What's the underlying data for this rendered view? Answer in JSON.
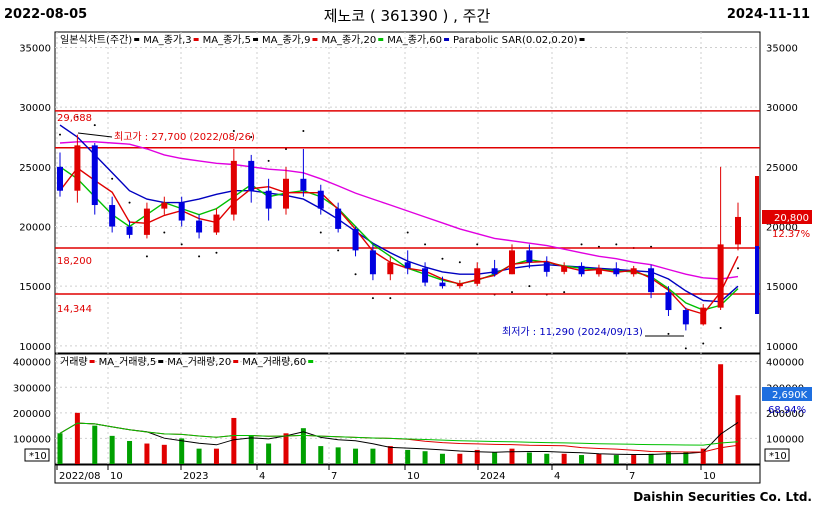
{
  "header": {
    "start_date": "2022-08-05",
    "title": "제노코 ( 361390 ) , 주간",
    "end_date": "2024-11-11"
  },
  "footer": {
    "brand": "Daishin Securities Co. Ltd."
  },
  "legend_price": [
    {
      "label": "일본식차트(주간)",
      "color": "#000000"
    },
    {
      "label": "MA_종가,3",
      "color": "#e00000"
    },
    {
      "label": "MA_종가,5",
      "color": "#000000"
    },
    {
      "label": "MA_종가,9",
      "color": "#e00000"
    },
    {
      "label": "MA_종가,20",
      "color": "#00c000"
    },
    {
      "label": "MA_종가,60",
      "color": "#0000c0"
    },
    {
      "label": "Parabolic SAR(0.02,0.20)",
      "color": "#000000"
    }
  ],
  "legend_volume": [
    {
      "label": "거래량",
      "color": "#e00000"
    },
    {
      "label": "MA_거래량,5",
      "color": "#000000"
    },
    {
      "label": "MA_거래량,20",
      "color": "#e00000"
    },
    {
      "label": "MA_거래량,60",
      "color": "#00c000"
    }
  ],
  "price_axis": {
    "ticks": [
      "35000",
      "30000",
      "25000",
      "20000",
      "15000",
      "10000"
    ]
  },
  "volume_axis": {
    "ticks": [
      "400000",
      "300000",
      "200000",
      "100000"
    ],
    "unit": "*10"
  },
  "x_ticks": [
    "2022/08",
    "10",
    "2023",
    "4",
    "7",
    "10",
    "2024",
    "4",
    "7",
    "10"
  ],
  "levels": [
    {
      "label": "29,688",
      "value": 29688
    },
    {
      "label": "",
      "value": 26600
    },
    {
      "label": "18,200",
      "value": 18200
    },
    {
      "label": "14,344",
      "value": 14344
    }
  ],
  "annotations": {
    "high": "최고가 : 27,700 (2022/08/26)",
    "low": "최저가 : 11,290 (2024/09/13)"
  },
  "badges": {
    "price": "20,800",
    "price_pct": "12.37%",
    "volume": "2,690K",
    "volume_pct": "68.94%"
  },
  "colors": {
    "up": "#e00000",
    "down": "#0000e0",
    "ma3": "#e00000",
    "ma20": "#00c000",
    "ma60": "#0000c0",
    "ma120": "#e000e0",
    "level": "#e00000",
    "sar": "#000000"
  },
  "chart_data": {
    "type": "candlestick",
    "series": [
      {
        "name": "MA_종가,20",
        "values": [
          25000,
          24000,
          22500,
          21000,
          20000,
          21000,
          22000,
          21500,
          21000,
          21500,
          22500,
          23500,
          22500,
          22800,
          23000,
          22500,
          21500,
          20000,
          18500,
          17500,
          16500,
          16000,
          15500,
          15200,
          15500,
          16000,
          16800,
          17200,
          17000,
          16700,
          16500,
          16400,
          16300,
          16200,
          15800,
          14800,
          13600,
          13000,
          13400,
          14800
        ]
      },
      {
        "name": "MA_종가,60",
        "values": [
          28500,
          27500,
          26000,
          24500,
          23000,
          22300,
          22000,
          22000,
          22300,
          22700,
          23000,
          23000,
          22800,
          22600,
          22300,
          21500,
          20600,
          19600,
          18600,
          17800,
          17100,
          16600,
          16200,
          16000,
          16000,
          16200,
          16500,
          16700,
          16800,
          16700,
          16600,
          16500,
          16400,
          16300,
          16200,
          15600,
          14600,
          13800,
          13700,
          15000
        ]
      }
    ],
    "candles": [
      {
        "o": 25000,
        "h": 26200,
        "l": 22500,
        "c": 23000
      },
      {
        "o": 23000,
        "h": 27700,
        "l": 22000,
        "c": 26800
      },
      {
        "o": 26800,
        "h": 27000,
        "l": 21000,
        "c": 21800
      },
      {
        "o": 21800,
        "h": 22500,
        "l": 19500,
        "c": 20000
      },
      {
        "o": 20000,
        "h": 20500,
        "l": 19000,
        "c": 19300
      },
      {
        "o": 19300,
        "h": 22000,
        "l": 19000,
        "c": 21500
      },
      {
        "o": 21500,
        "h": 22500,
        "l": 21000,
        "c": 22000
      },
      {
        "o": 22000,
        "h": 22500,
        "l": 20000,
        "c": 20500
      },
      {
        "o": 20500,
        "h": 21000,
        "l": 19000,
        "c": 19500
      },
      {
        "o": 19500,
        "h": 21500,
        "l": 19300,
        "c": 21000
      },
      {
        "o": 21000,
        "h": 26500,
        "l": 20500,
        "c": 25500
      },
      {
        "o": 25500,
        "h": 26000,
        "l": 22000,
        "c": 23000
      },
      {
        "o": 23000,
        "h": 24000,
        "l": 20500,
        "c": 21500
      },
      {
        "o": 21500,
        "h": 25000,
        "l": 21000,
        "c": 24000
      },
      {
        "o": 24000,
        "h": 26500,
        "l": 22500,
        "c": 23000
      },
      {
        "o": 23000,
        "h": 23500,
        "l": 21000,
        "c": 21500
      },
      {
        "o": 21500,
        "h": 22000,
        "l": 19500,
        "c": 19800
      },
      {
        "o": 19800,
        "h": 20000,
        "l": 17500,
        "c": 18000
      },
      {
        "o": 18000,
        "h": 18500,
        "l": 15500,
        "c": 16000
      },
      {
        "o": 16000,
        "h": 17500,
        "l": 15500,
        "c": 17000
      },
      {
        "o": 17000,
        "h": 18000,
        "l": 16000,
        "c": 16500
      },
      {
        "o": 16500,
        "h": 17000,
        "l": 15000,
        "c": 15300
      },
      {
        "o": 15300,
        "h": 15800,
        "l": 14800,
        "c": 15000
      },
      {
        "o": 15000,
        "h": 15500,
        "l": 14800,
        "c": 15200
      },
      {
        "o": 15200,
        "h": 17000,
        "l": 15000,
        "c": 16500
      },
      {
        "o": 16500,
        "h": 17200,
        "l": 15800,
        "c": 16000
      },
      {
        "o": 16000,
        "h": 18500,
        "l": 16000,
        "c": 18000
      },
      {
        "o": 18000,
        "h": 18500,
        "l": 16500,
        "c": 17000
      },
      {
        "o": 17000,
        "h": 17500,
        "l": 15800,
        "c": 16200
      },
      {
        "o": 16200,
        "h": 17000,
        "l": 16000,
        "c": 16700
      },
      {
        "o": 16700,
        "h": 17000,
        "l": 15800,
        "c": 16000
      },
      {
        "o": 16000,
        "h": 16800,
        "l": 15800,
        "c": 16500
      },
      {
        "o": 16500,
        "h": 17000,
        "l": 15800,
        "c": 16000
      },
      {
        "o": 16000,
        "h": 16700,
        "l": 15800,
        "c": 16500
      },
      {
        "o": 16500,
        "h": 16800,
        "l": 14000,
        "c": 14500
      },
      {
        "o": 14500,
        "h": 15000,
        "l": 12500,
        "c": 13000
      },
      {
        "o": 13000,
        "h": 13200,
        "l": 11290,
        "c": 11800
      },
      {
        "o": 11800,
        "h": 13500,
        "l": 11700,
        "c": 13200
      },
      {
        "o": 13200,
        "h": 25000,
        "l": 13000,
        "c": 18500
      },
      {
        "o": 18500,
        "h": 22000,
        "l": 18000,
        "c": 20800
      }
    ],
    "volume": [
      120000,
      200000,
      150000,
      110000,
      90000,
      80000,
      75000,
      100000,
      60000,
      60000,
      180000,
      110000,
      80000,
      120000,
      140000,
      70000,
      65000,
      60000,
      60000,
      70000,
      55000,
      50000,
      40000,
      40000,
      55000,
      45000,
      60000,
      45000,
      40000,
      40000,
      35000,
      40000,
      35000,
      35000,
      40000,
      50000,
      45000,
      60000,
      390000,
      269000
    ],
    "x": [
      "2022/08",
      "10",
      "2023",
      "4",
      "7",
      "10",
      "2024",
      "4",
      "7",
      "10"
    ],
    "ylim": [
      10000,
      35000
    ],
    "grid": true
  }
}
